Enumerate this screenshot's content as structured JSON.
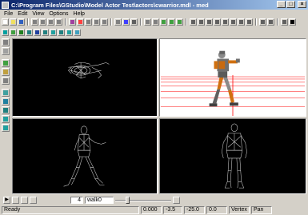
{
  "window": {
    "title": "C:\\Program Files\\GStudio\\Model Actor Test\\actors\\cwarrior.mdl - med"
  },
  "window_buttons": {
    "minimize": "_",
    "maximize": "□",
    "close": "×"
  },
  "menu": [
    "File",
    "Edit",
    "View",
    "Options",
    "Help"
  ],
  "toolbar1_colors": [
    "#ffffff",
    "#f0e060",
    "#3060c0",
    "#808080",
    "#808080",
    "#808080",
    "#808080",
    "#a040a0",
    "#ff4040",
    "#808080",
    "#808080",
    "#808080",
    "#808080",
    "#4040ff",
    "#606060",
    "#808080",
    "#808080",
    "#40a040",
    "#40a040",
    "#40a040",
    "#606060",
    "#606060",
    "#606060",
    "#606060",
    "#606060",
    "#606060",
    "#606060",
    "#606060",
    "#606060",
    "#606060",
    "#606060",
    "#000000"
  ],
  "toolbar2_colors": [
    "#00a0a0",
    "#40a040",
    "#208020",
    "#208080",
    "#2040a0",
    "#208080",
    "#20a0a0",
    "#208080",
    "#20a0a0",
    "#40a0c0"
  ],
  "left_tools_colors": [
    "#808080",
    "#a0a0a0",
    "#40a040",
    "#c0a040",
    "#808080",
    "#40a0a0",
    "#2080a0",
    "#208080",
    "#20a0a0",
    "#20a0a0"
  ],
  "playbar": {
    "play": "▶",
    "frame": "4",
    "anim": "walk0",
    "slider_position": 0.2
  },
  "status": {
    "ready": "Ready",
    "x": "0.000",
    "y": "-3.5",
    "z": "-25.0",
    "w": "0.0",
    "mode": "Vertex",
    "tool": "Pan"
  }
}
